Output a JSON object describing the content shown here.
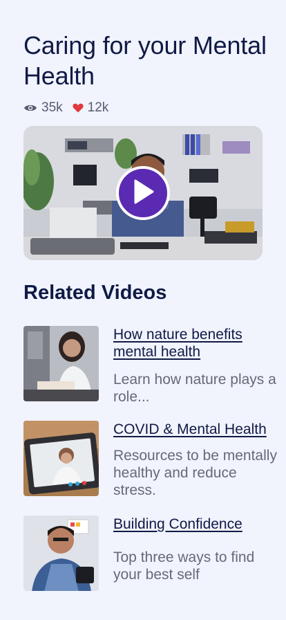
{
  "header": {
    "title": "Caring for your Mental Health",
    "views": "35k",
    "likes": "12k"
  },
  "hero": {
    "image_alt": "Man recording a video at a desk",
    "play_icon": "play-icon"
  },
  "related": {
    "heading": "Related Videos",
    "items": [
      {
        "title": "How nature benefits mental health",
        "description": "Learn how nature plays a role..."
      },
      {
        "title": "COVID & Mental Health",
        "description": "Resources to be mentally healthy and reduce stress."
      },
      {
        "title": "Building Confidence",
        "description": "Top three ways to find your best self"
      }
    ]
  },
  "colors": {
    "background": "#f1f3fd",
    "heading": "#0f1a45",
    "muted": "#666a78",
    "accent": "#5b2ab3",
    "like": "#e0393e"
  }
}
